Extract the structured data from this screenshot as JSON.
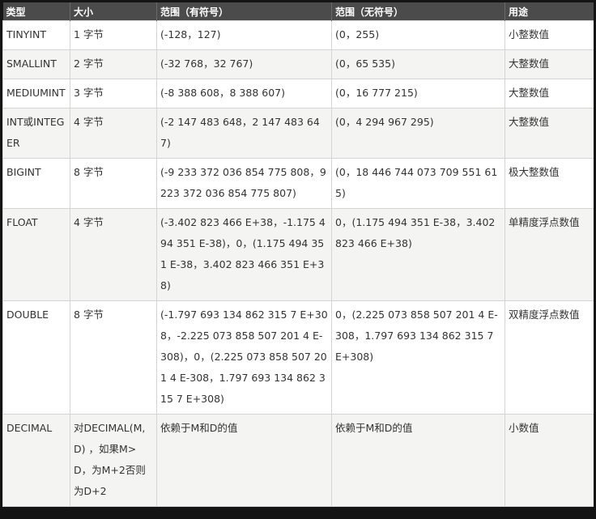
{
  "table": {
    "headers": [
      "类型",
      "大小",
      "范围（有符号）",
      "范围（无符号）",
      "用途"
    ],
    "rows": [
      [
        "TINYINT",
        "1 字节",
        "(-128，127)",
        "(0，255)",
        "小整数值"
      ],
      [
        "SMALLINT",
        "2 字节",
        "(-32 768，32 767)",
        "(0，65 535)",
        "大整数值"
      ],
      [
        "MEDIUMINT",
        "3 字节",
        "(-8 388 608，8 388 607)",
        "(0，16 777 215)",
        "大整数值"
      ],
      [
        "INT或INTEGER",
        "4 字节",
        "(-2 147 483 648，2 147 483 647)",
        "(0，4 294 967 295)",
        "大整数值"
      ],
      [
        "BIGINT",
        "8 字节",
        "(-9 233 372 036 854 775 808，9 223 372 036 854 775 807)",
        "(0，18 446 744 073 709 551 615)",
        "极大整数值"
      ],
      [
        "FLOAT",
        "4 字节",
        "(-3.402 823 466 E+38，-1.175 494 351 E-38)，0，(1.175 494 351 E-38，3.402 823 466 351 E+38)",
        "0，(1.175 494 351 E-38，3.402 823 466 E+38)",
        "单精度浮点数值"
      ],
      [
        "DOUBLE",
        "8 字节",
        "(-1.797 693 134 862 315 7 E+308，-2.225 073 858 507 201 4 E-308)，0，(2.225 073 858 507 201 4 E-308，1.797 693 134 862 315 7 E+308)",
        "0，(2.225 073 858 507 201 4 E-308，1.797 693 134 862 315 7 E+308)",
        "双精度浮点数值"
      ],
      [
        "DECIMAL",
        "对DECIMAL(M,D) ，如果M>D，为M+2否则为D+2",
        "依赖于M和D的值",
        "依赖于M和D的值",
        "小数值"
      ]
    ]
  }
}
